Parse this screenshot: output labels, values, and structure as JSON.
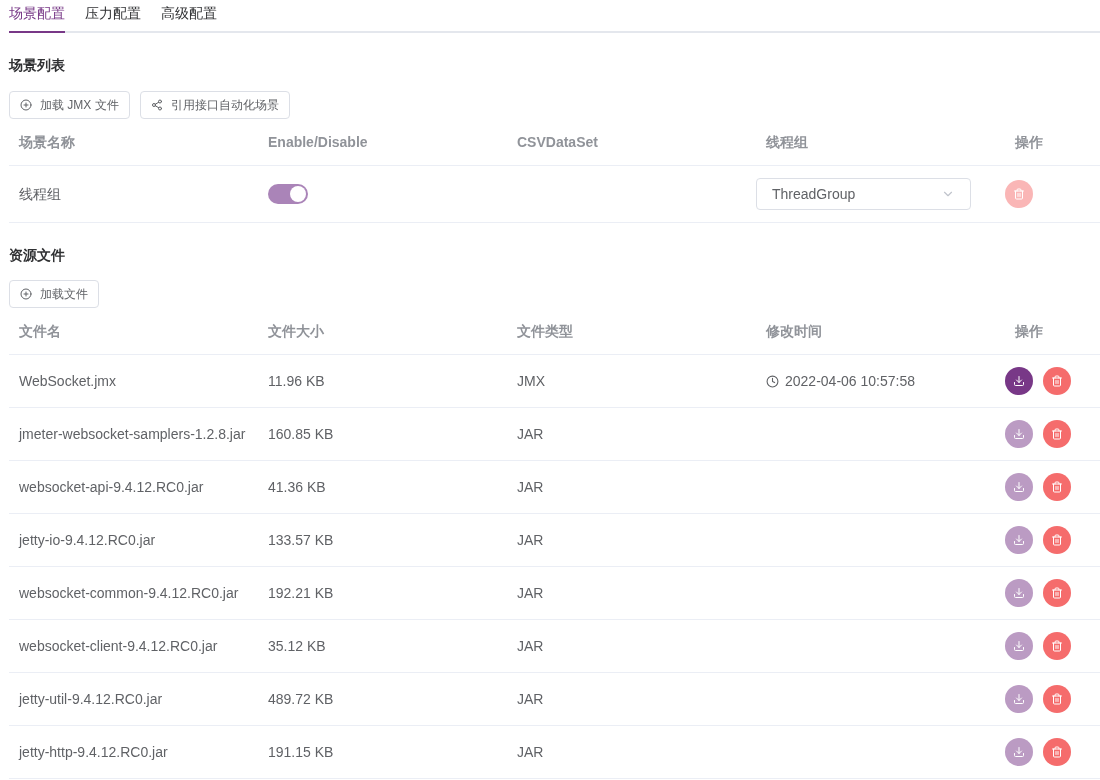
{
  "tabs": [
    {
      "label": "场景配置",
      "selected": true
    },
    {
      "label": "压力配置",
      "selected": false
    },
    {
      "label": "高级配置",
      "selected": false
    }
  ],
  "scenario_section": {
    "title": "场景列表",
    "buttons": [
      {
        "label": "加载 JMX 文件",
        "kind": "add"
      },
      {
        "label": "引用接口自动化场景",
        "kind": "share"
      }
    ],
    "columns": [
      "场景名称",
      "Enable/Disable",
      "CSVDataSet",
      "线程组",
      "操作"
    ],
    "rows": [
      {
        "name": "线程组",
        "enabled": true,
        "thread_group": "ThreadGroup",
        "delete_disabled": true
      }
    ]
  },
  "resource_section": {
    "title": "资源文件",
    "buttons": [
      {
        "label": "加载文件",
        "kind": "add"
      }
    ],
    "columns": [
      "文件名",
      "文件大小",
      "文件类型",
      "修改时间",
      "操作"
    ],
    "rows": [
      {
        "name": "WebSocket.jmx",
        "size": "11.96 KB",
        "type": "JMX",
        "modified": "2022-04-06 10:57:58",
        "download_disabled": false
      },
      {
        "name": "jmeter-websocket-samplers-1.2.8.jar",
        "size": "160.85 KB",
        "type": "JAR",
        "download_disabled": true
      },
      {
        "name": "websocket-api-9.4.12.RC0.jar",
        "size": "41.36 KB",
        "type": "JAR",
        "download_disabled": true
      },
      {
        "name": "jetty-io-9.4.12.RC0.jar",
        "size": "133.57 KB",
        "type": "JAR",
        "download_disabled": true
      },
      {
        "name": "websocket-common-9.4.12.RC0.jar",
        "size": "192.21 KB",
        "type": "JAR",
        "download_disabled": true
      },
      {
        "name": "websocket-client-9.4.12.RC0.jar",
        "size": "35.12 KB",
        "type": "JAR",
        "download_disabled": true
      },
      {
        "name": "jetty-util-9.4.12.RC0.jar",
        "size": "489.72 KB",
        "type": "JAR",
        "download_disabled": true
      },
      {
        "name": "jetty-http-9.4.12.RC0.jar",
        "size": "191.15 KB",
        "type": "JAR",
        "download_disabled": true
      }
    ]
  }
}
